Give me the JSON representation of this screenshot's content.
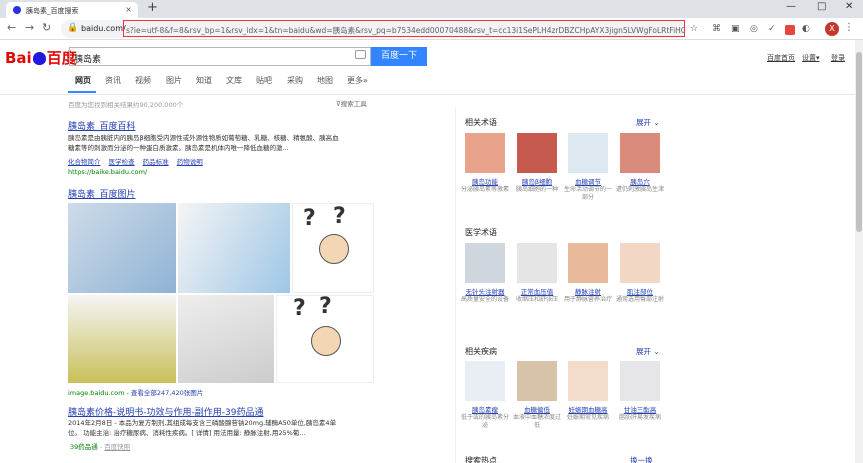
{
  "browser": {
    "tab_title": "胰岛素_百度搜索",
    "close": "×",
    "new_tab": "+",
    "window_controls": [
      "—",
      "□",
      "✕"
    ],
    "host": "baidu.com/",
    "url": "s?ie=utf-8&f=8&rsv_bp=1&rsv_idx=1&tn=baidu&wd=胰岛素&rsv_pq=b7534edd00070488&rsv_t=cc13i1SePLH4zrDBZCHpAYX3jign5LVWgFoLRtFiHOFDq%2B...",
    "avatar_letter": "X"
  },
  "baidu": {
    "logo_a": "Bai",
    "logo_b": "百度",
    "query": "胰岛素",
    "search_button": "百度一下",
    "top_links": [
      "百度首页",
      "设置▾",
      "登录"
    ],
    "tabs": [
      "网页",
      "资讯",
      "视频",
      "图片",
      "知道",
      "文库",
      "贴吧",
      "采购",
      "地图",
      "更多»"
    ],
    "result_count": "百度为您找到相关结果约90,200,000个",
    "search_tools": "搜索工具"
  },
  "results": {
    "r1": {
      "title": "胰岛素_百度百科",
      "para1": "胰岛素是由胰脏内的胰岛β细胞受内源性或外源性物质如葡萄糖、乳糖、核糖、精氨酸、胰高血",
      "para2": "糖素等的刺激而分泌的一种蛋白质激素。胰岛素是机体内唯一降低血糖的激...",
      "links": [
        "化合物简介",
        "医学检查",
        "药品标准",
        "药物说明"
      ],
      "url": "https://baike.baidu.com/"
    },
    "r2": {
      "title": "胰岛素_百度图片",
      "img_source": "image.baidu.com",
      "img_more": "查看全部247,420张图片"
    },
    "r3": {
      "title": "胰岛素价格-说明书-功效与作用-副作用-39药品通",
      "para1": "2014年2月8日 - 本品为复方制剂,其组成每支含三磷酸腺苷钠20mg,辅酶A50单位,胰岛素4单",
      "para2": "位。 功能主治: 治疗糖尿病、消耗性疾病。[ 详情] 用法用量: 静脉注射,用25%葡...",
      "source": "39药品通",
      "snapshot": "百度快照"
    }
  },
  "sidebar": {
    "expand_label": "展开",
    "sections": [
      {
        "title": "相关术语",
        "items": [
          {
            "name": "胰岛功能",
            "desc": "分泌胰岛素等激素"
          },
          {
            "name": "胰岛β细胞",
            "desc": "胰岛细胞的一种"
          },
          {
            "name": "血糖调节",
            "desc": "生命活动调节的一部分"
          },
          {
            "name": "胰岛穴",
            "desc": "遭仍刺激胰岛生津"
          }
        ]
      },
      {
        "title": "医学术语",
        "items": [
          {
            "name": "无针头注射器",
            "desc": "高质量安全的设备"
          },
          {
            "name": "正常血压值",
            "desc": "收缩压和舒张压"
          },
          {
            "name": "静脉注射",
            "desc": "用于静脉营养治疗"
          },
          {
            "name": "肌注部位",
            "desc": "通常选用臀部注射"
          }
        ]
      },
      {
        "title": "相关疾病",
        "items": [
          {
            "name": "胰岛素瘤",
            "desc": "低于或的胰岛素分泌"
          },
          {
            "name": "血糖偏低",
            "desc": "血液中血糖浓度过低"
          },
          {
            "name": "妊娠期血糖高",
            "desc": "妊娠期常见疾病"
          },
          {
            "name": "甘油三酯高",
            "desc": "脂肪肝易发疾病"
          }
        ]
      }
    ],
    "hot_title": "搜索热点",
    "refresh": "换一换"
  }
}
